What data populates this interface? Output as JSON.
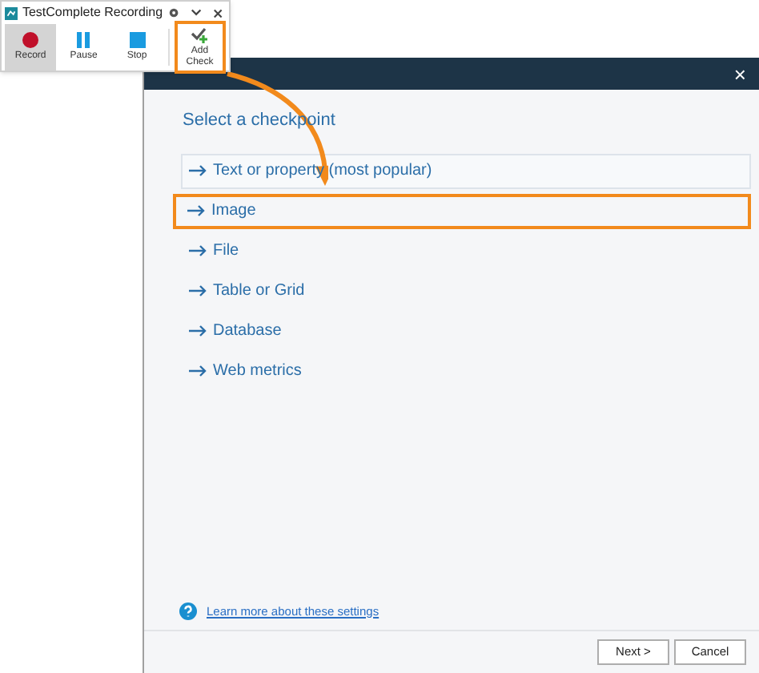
{
  "recorder": {
    "title": "TestComplete Recording",
    "buttons": [
      {
        "label": "Record",
        "kind": "record",
        "selected": true,
        "highlighted": false
      },
      {
        "label": "Pause",
        "kind": "pause",
        "selected": false,
        "highlighted": false
      },
      {
        "label": "Stop",
        "kind": "stop",
        "selected": false,
        "highlighted": false
      },
      {
        "label": "Add\nCheck",
        "kind": "check",
        "selected": false,
        "highlighted": true
      }
    ]
  },
  "dialog": {
    "close": "×",
    "heading": "Select a checkpoint",
    "options": [
      {
        "label": "Text or property (most popular)",
        "highlighted": false,
        "boxed": true
      },
      {
        "label": "Image",
        "highlighted": true,
        "boxed": false
      },
      {
        "label": "File",
        "highlighted": false,
        "boxed": false
      },
      {
        "label": "Table or Grid",
        "highlighted": false,
        "boxed": false
      },
      {
        "label": "Database",
        "highlighted": false,
        "boxed": false
      },
      {
        "label": "Web metrics",
        "highlighted": false,
        "boxed": false
      }
    ],
    "help_link": "Learn more about these settings",
    "buttons": [
      "Next >",
      "Cancel"
    ]
  }
}
